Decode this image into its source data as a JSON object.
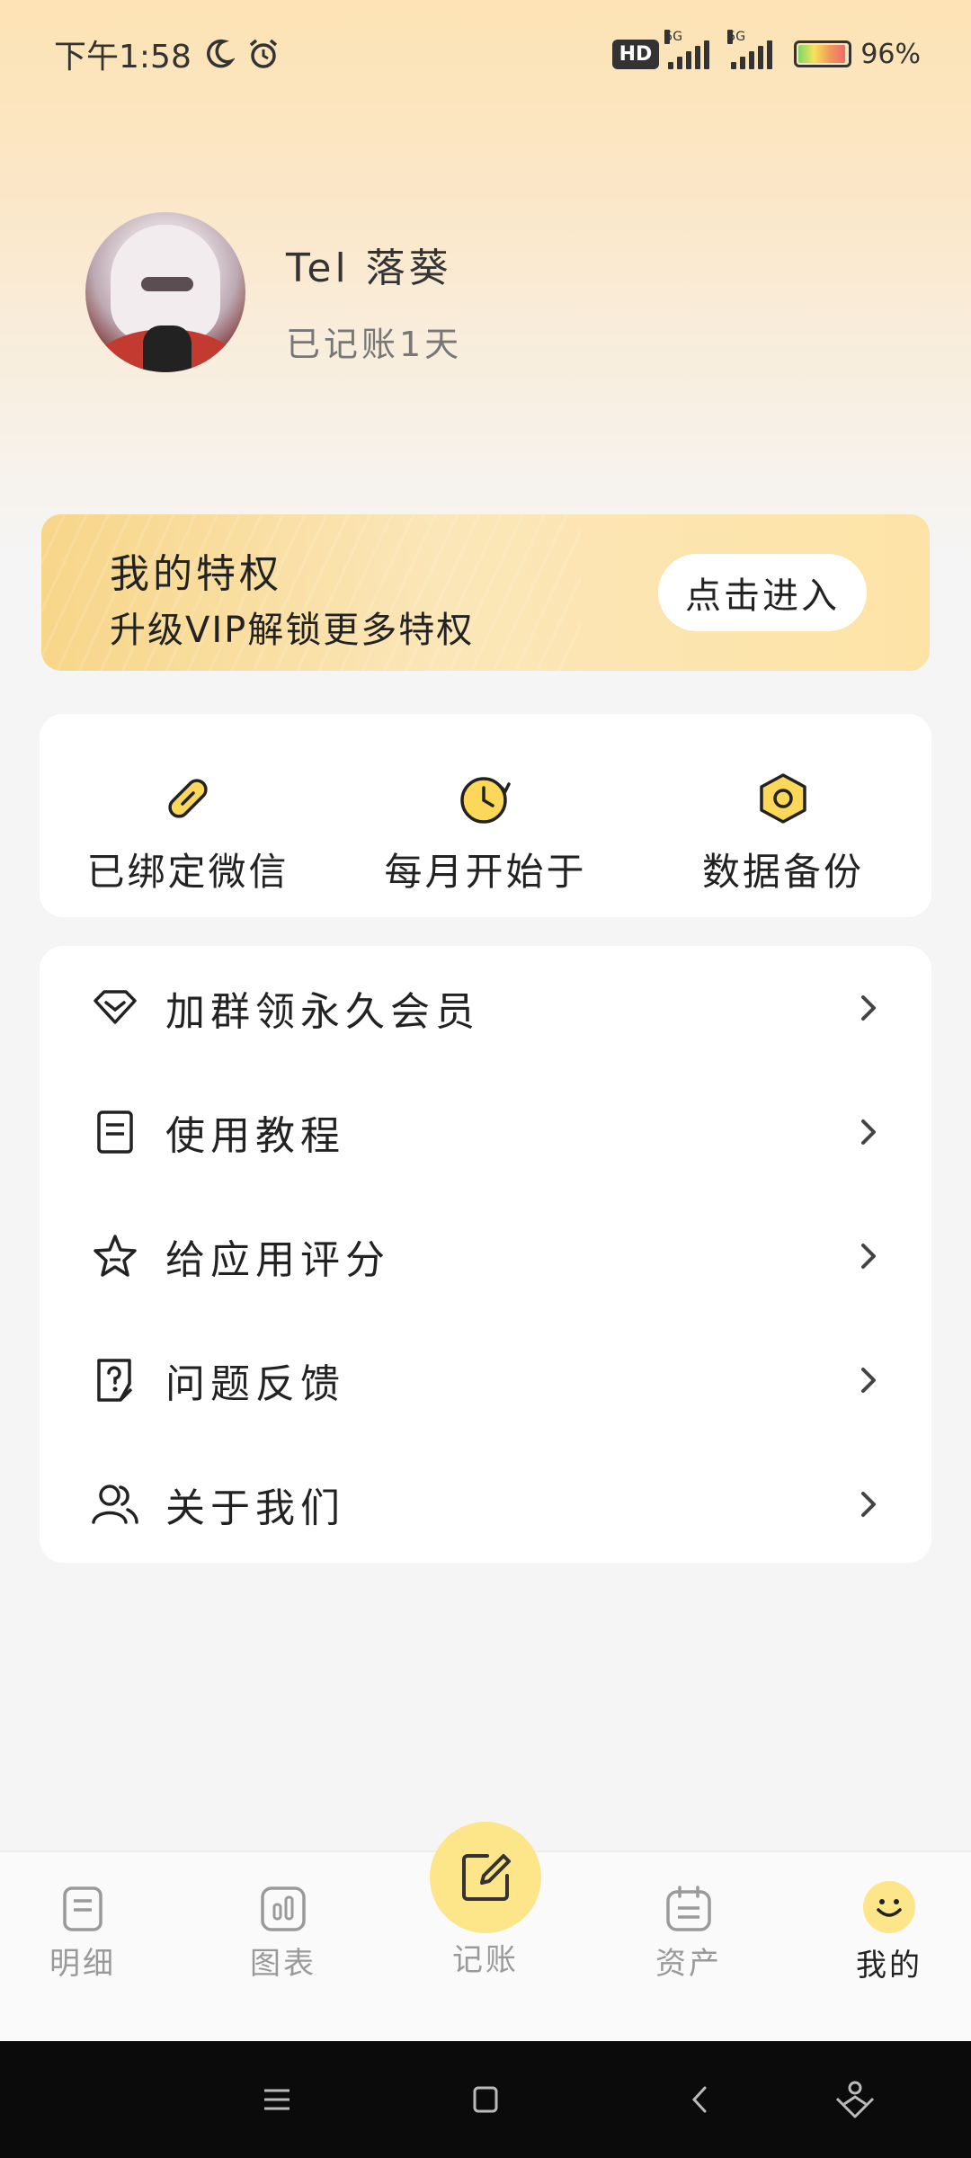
{
  "status_bar": {
    "time": "下午1:58",
    "network_hd": "HD",
    "network_1": "5G",
    "network_2": "5G",
    "battery": "96%",
    "battery_level": 0.96
  },
  "profile": {
    "username": "Tel 落葵",
    "days_text": "已记账1天"
  },
  "vip": {
    "title": "我的特权",
    "description": "升级VIP解锁更多特权",
    "button": "点击进入"
  },
  "quick_actions": [
    {
      "label": "已绑定微信",
      "icon": "paperclip-icon"
    },
    {
      "label": "每月开始于",
      "icon": "clock-icon"
    },
    {
      "label": "数据备份",
      "icon": "hexagon-icon"
    }
  ],
  "menu": [
    {
      "label": "加群领永久会员",
      "icon": "diamond-icon"
    },
    {
      "label": "使用教程",
      "icon": "document-icon"
    },
    {
      "label": "给应用评分",
      "icon": "star-icon"
    },
    {
      "label": "问题反馈",
      "icon": "question-icon"
    },
    {
      "label": "关于我们",
      "icon": "users-icon"
    }
  ],
  "bottom_nav": {
    "items": [
      {
        "label": "明细",
        "icon": "list-icon"
      },
      {
        "label": "图表",
        "icon": "chart-icon"
      },
      {
        "label": "记账",
        "icon": "edit-icon"
      },
      {
        "label": "资产",
        "icon": "wallet-icon"
      },
      {
        "label": "我的",
        "icon": "smiley-icon"
      }
    ],
    "active_index": 4
  },
  "colors": {
    "accent": "#fde58a",
    "icon_yellow": "#fbd85a",
    "background": "#f5f5f5"
  }
}
